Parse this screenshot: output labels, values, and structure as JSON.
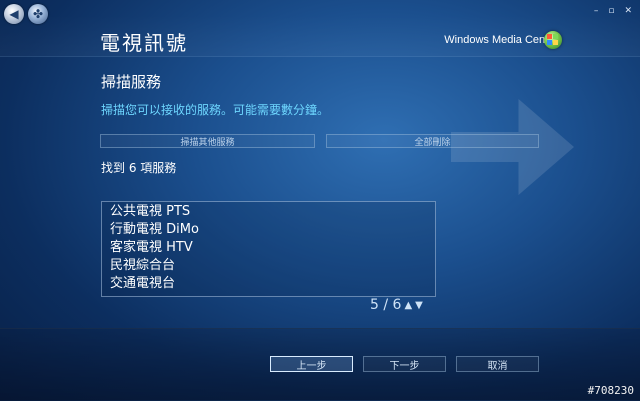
{
  "window": {
    "minimize_label": "–",
    "maximize_label": "▫",
    "close_label": "✕"
  },
  "header": {
    "title": "電視訊號",
    "brand": "Windows Media Center"
  },
  "main": {
    "section_title": "掃描服務",
    "instruction": "掃描您可以接收的服務。可能需要數分鐘。",
    "scan_other_label": "掃描其他服務",
    "delete_all_label": "全部刪除",
    "found_text": "找到 6 項服務",
    "services": [
      "公共電視 PTS",
      "行動電視 DiMo",
      "客家電視 HTV",
      "民視綜合台",
      "交通電視台"
    ],
    "pager": {
      "text": "5 / 6",
      "up_icon": "chevron-up-icon",
      "down_icon": "chevron-down-icon"
    }
  },
  "footer": {
    "prev_label": "上一步",
    "next_label": "下一步",
    "cancel_label": "取消"
  },
  "watermark": "#708230",
  "colors": {
    "instruction": "#6ed7ff",
    "background_dark": "#081f45",
    "background_light": "#2f6fb3"
  }
}
